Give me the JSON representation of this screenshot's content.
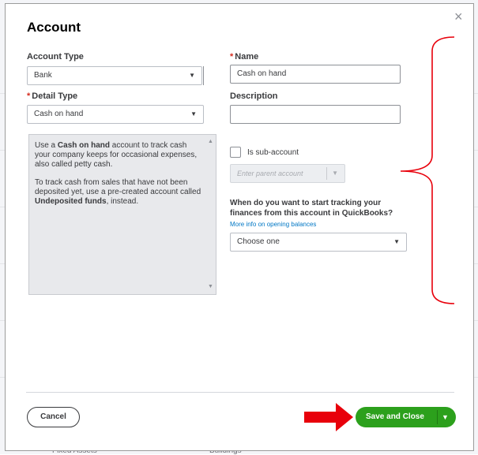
{
  "background": {
    "footer_left": "Fixed Assets",
    "footer_right": "Buildings"
  },
  "modal": {
    "title": "Account",
    "close_icon": "×"
  },
  "form": {
    "account_type": {
      "label": "Account Type",
      "value": "Bank",
      "arrow": "▼"
    },
    "name": {
      "label": "Name",
      "required_mark": "*",
      "value": "Cash on hand"
    },
    "detail_type": {
      "label": "Detail Type",
      "required_mark": "*",
      "value": "Cash on hand",
      "arrow": "▼"
    },
    "description": {
      "label": "Description",
      "value": ""
    },
    "help": {
      "p1_pre": "Use a ",
      "p1_bold": "Cash on hand",
      "p1_post": " account to track cash your company keeps for occasional expenses, also called petty cash.",
      "p2_pre": "To track cash from sales that have not been deposited yet, use a pre-created account called ",
      "p2_bold": "Undeposited funds",
      "p2_post": ", instead.",
      "scroll_up": "▲",
      "scroll_down": "▼"
    },
    "sub_account": {
      "label": "Is sub-account",
      "checked": false,
      "parent_placeholder": "Enter parent account",
      "arrow": "▼"
    },
    "tracking": {
      "question": "When do you want to start tracking your finances from this account in QuickBooks?",
      "link": "More info on opening balances",
      "select_value": "Choose one",
      "arrow": "▼"
    }
  },
  "footer": {
    "cancel_label": "Cancel",
    "save_label": "Save and Close",
    "save_caret": "▼"
  },
  "colors": {
    "brand_green": "#2ca01c",
    "link_blue": "#0077c5",
    "annotation_red": "#e8000b",
    "required_red": "#d52b1e"
  }
}
